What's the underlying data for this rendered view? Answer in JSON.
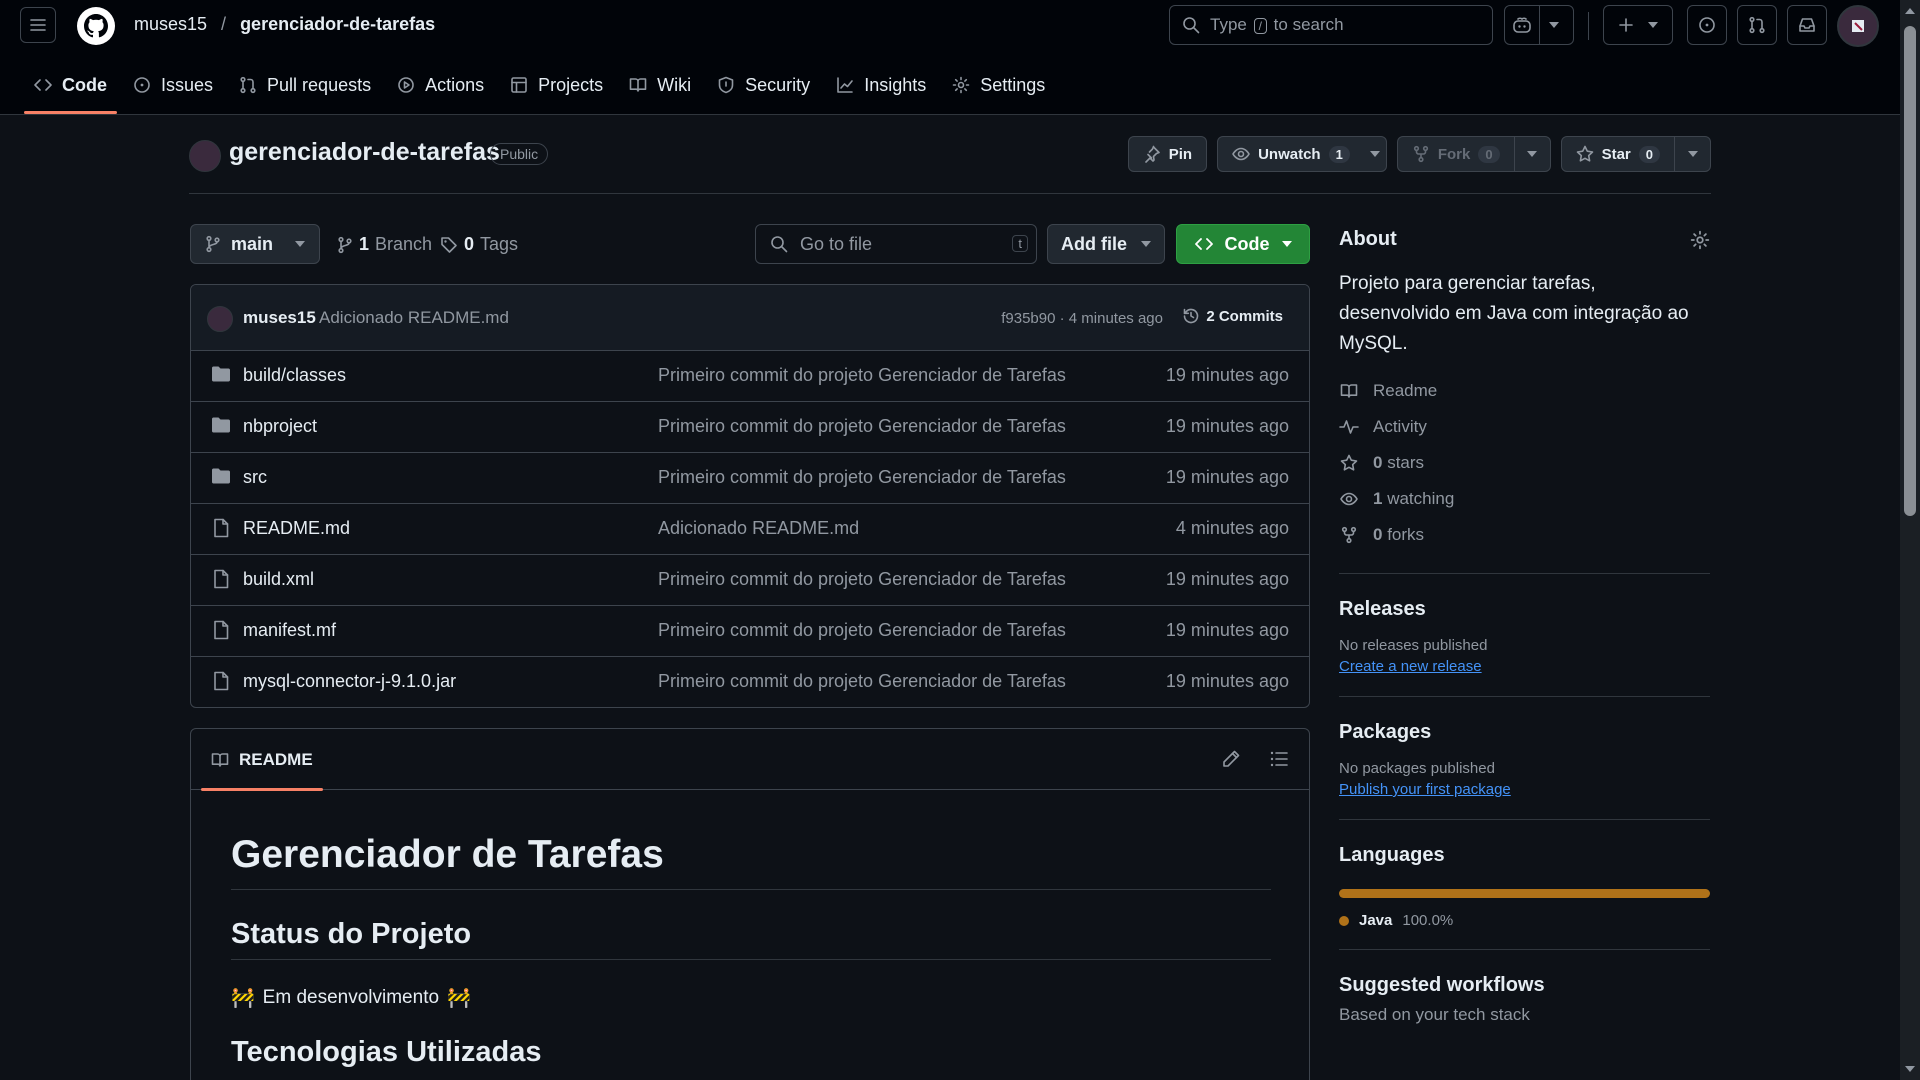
{
  "header": {
    "owner": "muses15",
    "separator": "/",
    "repo": "gerenciador-de-tarefas",
    "search_prefix": "Type",
    "search_key": "/",
    "search_suffix": "to search"
  },
  "nav": {
    "tabs": [
      {
        "label": "Code",
        "icon": "code-icon"
      },
      {
        "label": "Issues",
        "icon": "issue-icon"
      },
      {
        "label": "Pull requests",
        "icon": "pull-request-icon"
      },
      {
        "label": "Actions",
        "icon": "play-icon"
      },
      {
        "label": "Projects",
        "icon": "table-icon"
      },
      {
        "label": "Wiki",
        "icon": "book-icon"
      },
      {
        "label": "Security",
        "icon": "shield-icon"
      },
      {
        "label": "Insights",
        "icon": "graph-icon"
      },
      {
        "label": "Settings",
        "icon": "gear-icon"
      }
    ]
  },
  "repo": {
    "name": "gerenciador-de-tarefas",
    "visibility": "Public",
    "pin": "Pin",
    "unwatch": "Unwatch",
    "watch_count": "1",
    "fork": "Fork",
    "fork_count": "0",
    "star": "Star",
    "star_count": "0"
  },
  "toolbar": {
    "branch": "main",
    "branch_count": "1",
    "branch_label": "Branch",
    "tag_count": "0",
    "tag_label": "Tags",
    "goto_placeholder": "Go to file",
    "goto_key": "t",
    "add_file": "Add file",
    "code": "Code"
  },
  "latest_commit": {
    "user": "muses15",
    "message": "Adicionado README.md",
    "meta": "f935b90 · 4 minutes ago",
    "commits_label": "2 Commits"
  },
  "files": [
    {
      "type": "folder",
      "name": "build/classes",
      "message": "Primeiro commit do projeto Gerenciador de Tarefas",
      "time": "19 minutes ago"
    },
    {
      "type": "folder",
      "name": "nbproject",
      "message": "Primeiro commit do projeto Gerenciador de Tarefas",
      "time": "19 minutes ago"
    },
    {
      "type": "folder",
      "name": "src",
      "message": "Primeiro commit do projeto Gerenciador de Tarefas",
      "time": "19 minutes ago"
    },
    {
      "type": "file",
      "name": "README.md",
      "message": "Adicionado README.md",
      "time": "4 minutes ago"
    },
    {
      "type": "file",
      "name": "build.xml",
      "message": "Primeiro commit do projeto Gerenciador de Tarefas",
      "time": "19 minutes ago"
    },
    {
      "type": "file",
      "name": "manifest.mf",
      "message": "Primeiro commit do projeto Gerenciador de Tarefas",
      "time": "19 minutes ago"
    },
    {
      "type": "file",
      "name": "mysql-connector-j-9.1.0.jar",
      "message": "Primeiro commit do projeto Gerenciador de Tarefas",
      "time": "19 minutes ago"
    }
  ],
  "readme": {
    "tab": "README",
    "h1": "Gerenciador de Tarefas",
    "h2_status": "Status do Projeto",
    "status_emoji": "🚧",
    "status_text": "Em desenvolvimento",
    "h2_tech": "Tecnologias Utilizadas"
  },
  "about": {
    "title": "About",
    "description": "Projeto para gerenciar tarefas, desenvolvido em Java com integração ao MySQL.",
    "readme": "Readme",
    "activity": "Activity",
    "stars_count": "0",
    "stars_label": "stars",
    "watching_count": "1",
    "watching_label": "watching",
    "forks_count": "0",
    "forks_label": "forks"
  },
  "releases": {
    "title": "Releases",
    "empty": "No releases published",
    "link": "Create a new release"
  },
  "packages": {
    "title": "Packages",
    "empty": "No packages published",
    "link": "Publish your first package"
  },
  "languages": {
    "title": "Languages",
    "items": [
      {
        "name": "Java",
        "percent": "100.0%",
        "color": "#b07219",
        "share": 1.0
      }
    ]
  },
  "workflows": {
    "title": "Suggested workflows",
    "subtitle": "Based on your tech stack"
  },
  "colors": {
    "accent_underline": "#f78166",
    "code_button": "#238636",
    "link": "#4493f8"
  }
}
